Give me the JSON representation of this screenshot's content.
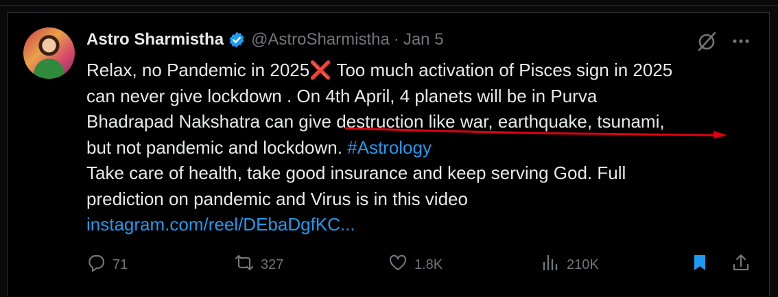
{
  "tweet": {
    "author_name": "Astro Sharmistha",
    "handle": "@AstroSharmistha",
    "separator": "·",
    "date": "Jan 5",
    "lines": {
      "l1_a": "Relax, no Pandemic in 2025",
      "l1_x": "❌",
      "l1_b": " Too much activation of Pisces sign in 2025",
      "l2": "can never give lockdown . On 4th April, 4 planets will be in Purva",
      "l3": "Bhadrapad Nakshatra can give destruction like war, earthquake, tsunami,",
      "l4_a": "but not pandemic and lockdown. ",
      "l4_hashtag": "#Astrology",
      "l5": "Take care of health, take good insurance and keep serving God. Full",
      "l6": "prediction on pandemic and Virus is in this video",
      "l7_link": "instagram.com/reel/DEbaDgfKC..."
    }
  },
  "actions": {
    "replies": "71",
    "reposts": "327",
    "likes": "1.8K",
    "views": "210K"
  },
  "icons": {
    "verified": "verified-badge-icon",
    "grok": "grok-icon",
    "more": "more-icon",
    "reply": "reply-icon",
    "repost": "repost-icon",
    "like": "like-icon",
    "views": "views-icon",
    "bookmark": "bookmark-icon",
    "share": "share-icon"
  },
  "colors": {
    "accent": "#1d9bf0",
    "muted": "#71767b",
    "annotation": "#e0000f"
  }
}
